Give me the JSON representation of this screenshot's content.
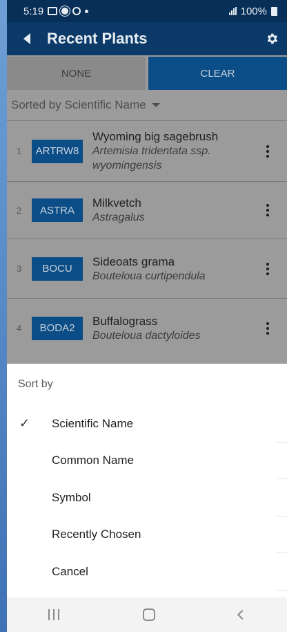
{
  "status_bar": {
    "time": "5:19",
    "battery": "100%"
  },
  "app_bar": {
    "title": "Recent Plants",
    "back_icon": "back-arrow-icon",
    "settings_icon": "gear-icon"
  },
  "toggles": {
    "none_label": "NONE",
    "clear_label": "CLEAR"
  },
  "sort_label": "Sorted by Scientific Name",
  "plants": [
    {
      "index": "1",
      "symbol": "ARTRW8",
      "common": "Wyoming big sagebrush",
      "scientific": "Artemisia tridentata ssp. wyomingensis"
    },
    {
      "index": "2",
      "symbol": "ASTRA",
      "common": "Milkvetch",
      "scientific": "Astragalus"
    },
    {
      "index": "3",
      "symbol": "BOCU",
      "common": "Sideoats grama",
      "scientific": "Bouteloua curtipendula"
    },
    {
      "index": "4",
      "symbol": "BODA2",
      "common": "Buffalograss",
      "scientific": "Bouteloua dactyloides"
    }
  ],
  "sort_sheet": {
    "title": "Sort by",
    "options": [
      {
        "label": "Scientific Name",
        "selected": true
      },
      {
        "label": "Common Name",
        "selected": false
      },
      {
        "label": "Symbol",
        "selected": false
      },
      {
        "label": "Recently Chosen",
        "selected": false
      },
      {
        "label": "Cancel",
        "selected": false
      }
    ],
    "check_mark": "✓"
  },
  "colors": {
    "app_bar": "#0b3a69",
    "status_bar": "#082f57",
    "symbol_badge": "#0b4d87",
    "dim_overlay_bg": "#9b9b9b",
    "sheet_bg": "#ffffff"
  }
}
